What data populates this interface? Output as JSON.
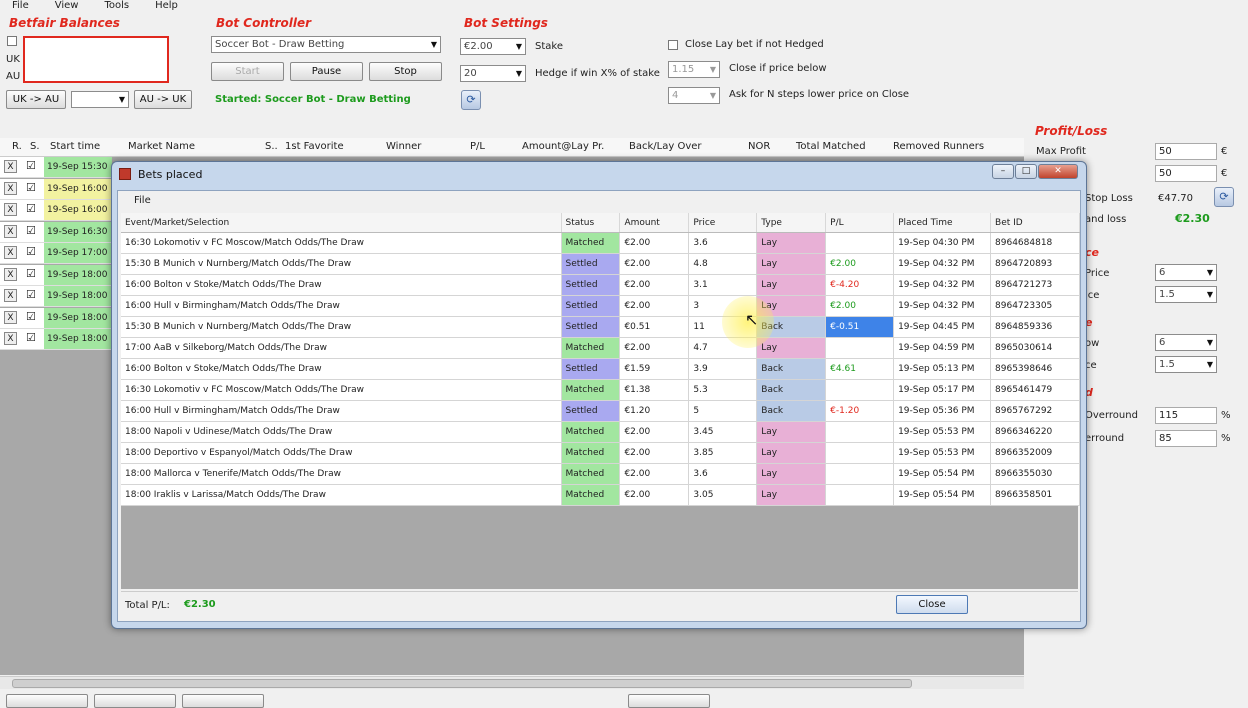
{
  "menu": [
    "File",
    "View",
    "Tools",
    "Help"
  ],
  "balances": {
    "title": "Betfair Balances",
    "uk_label": "UK",
    "au_label": "AU",
    "uk_to_au": "UK -> AU",
    "au_to_uk": "AU -> UK"
  },
  "bot_controller": {
    "title": "Bot Controller",
    "bot_select": "Soccer Bot - Draw Betting",
    "start": "Start",
    "pause": "Pause",
    "stop": "Stop",
    "status": "Started: Soccer Bot - Draw Betting"
  },
  "bot_settings": {
    "title": "Bot Settings",
    "stake_value": "€2.00",
    "stake_label": "Stake",
    "hedge_value": "20",
    "hedge_label": "Hedge if win X% of stake",
    "close_lay_label": "Close Lay bet if not Hedged",
    "close_price_value": "1.15",
    "close_price_label": "Close if price below",
    "ask_steps_value": "4",
    "ask_steps_label": "Ask for N steps lower price on Close"
  },
  "markets_grid": {
    "headers": [
      "R.",
      "S.",
      "Start time",
      "Market Name",
      "S..",
      "1st Favorite",
      "Winner",
      "P/L",
      "Amount@Lay Pr.",
      "Back/Lay Over",
      "NOR",
      "Total Matched",
      "Removed Runners"
    ],
    "rows": [
      {
        "x": "X",
        "chk": "☑",
        "time": "19-Sep 15:30",
        "color": "green"
      },
      {
        "x": "X",
        "chk": "☑",
        "time": "19-Sep 16:00",
        "color": "yellow"
      },
      {
        "x": "X",
        "chk": "☑",
        "time": "19-Sep 16:00",
        "color": "yellow"
      },
      {
        "x": "X",
        "chk": "☑",
        "time": "19-Sep 16:30",
        "color": "green"
      },
      {
        "x": "X",
        "chk": "☑",
        "time": "19-Sep 17:00",
        "color": "green"
      },
      {
        "x": "X",
        "chk": "☑",
        "time": "19-Sep 18:00",
        "color": "green"
      },
      {
        "x": "X",
        "chk": "☑",
        "time": "19-Sep 18:00",
        "color": "green"
      },
      {
        "x": "X",
        "chk": "☑",
        "time": "19-Sep 18:00",
        "color": "green"
      },
      {
        "x": "X",
        "chk": "☑",
        "time": "19-Sep 18:00",
        "color": "green"
      }
    ]
  },
  "profit_loss": {
    "title": "Profit/Loss",
    "max_profit_label": "Max Profit",
    "max_profit_value": "50",
    "max_profit_unit": "€",
    "row2_value": "50",
    "row2_unit": "€",
    "stop_loss_label": "Stop Loss",
    "stop_loss_value": "€47.70",
    "and_loss_label": "and loss",
    "and_loss_value": "€2.30",
    "section2_title": "ce",
    "price_label": "Price",
    "price_value": "6",
    "price2_label": "ice",
    "price2_value": "1.5",
    "section3_title": "e",
    "ow_label": "ow",
    "ow_value": "6",
    "ce_label": "ce",
    "ce_value": "1.5",
    "section4_title": "d",
    "overround_label": "Overround",
    "overround_value": "115",
    "overround_unit": "%",
    "erround_label": "erround",
    "erround_value": "85",
    "erround_unit": "%"
  },
  "dialog": {
    "title": "Bets placed",
    "menu_file": "File",
    "headers": [
      "Event/Market/Selection",
      "Status",
      "Amount",
      "Price",
      "Type",
      "P/L",
      "Placed Time",
      "Bet ID"
    ],
    "rows": [
      {
        "event": "16:30 Lokomotiv v FC Moscow/Match Odds/The Draw",
        "status": "Matched",
        "amount": "€2.00",
        "price": "3.6",
        "type": "Lay",
        "pl": "",
        "time": "19-Sep 04:30 PM",
        "id": "8964684818"
      },
      {
        "event": "15:30 B Munich v Nurnberg/Match Odds/The Draw",
        "status": "Settled",
        "amount": "€2.00",
        "price": "4.8",
        "type": "Lay",
        "pl": "€2.00",
        "time": "19-Sep 04:32 PM",
        "id": "8964720893"
      },
      {
        "event": "16:00 Bolton v Stoke/Match Odds/The Draw",
        "status": "Settled",
        "amount": "€2.00",
        "price": "3.1",
        "type": "Lay",
        "pl": "€-4.20",
        "time": "19-Sep 04:32 PM",
        "id": "8964721273"
      },
      {
        "event": "16:00 Hull v Birmingham/Match Odds/The Draw",
        "status": "Settled",
        "amount": "€2.00",
        "price": "3",
        "type": "Lay",
        "pl": "€2.00",
        "time": "19-Sep 04:32 PM",
        "id": "8964723305"
      },
      {
        "event": "15:30 B Munich v Nurnberg/Match Odds/The Draw",
        "status": "Settled",
        "amount": "€0.51",
        "price": "11",
        "type": "Back",
        "pl": "€-0.51",
        "time": "19-Sep 04:45 PM",
        "id": "8964859336"
      },
      {
        "event": "17:00 AaB v Silkeborg/Match Odds/The Draw",
        "status": "Matched",
        "amount": "€2.00",
        "price": "4.7",
        "type": "Lay",
        "pl": "",
        "time": "19-Sep 04:59 PM",
        "id": "8965030614"
      },
      {
        "event": "16:00 Bolton v Stoke/Match Odds/The Draw",
        "status": "Settled",
        "amount": "€1.59",
        "price": "3.9",
        "type": "Back",
        "pl": "€4.61",
        "time": "19-Sep 05:13 PM",
        "id": "8965398646"
      },
      {
        "event": "16:30 Lokomotiv v FC Moscow/Match Odds/The Draw",
        "status": "Matched",
        "amount": "€1.38",
        "price": "5.3",
        "type": "Back",
        "pl": "",
        "time": "19-Sep 05:17 PM",
        "id": "8965461479"
      },
      {
        "event": "16:00 Hull v Birmingham/Match Odds/The Draw",
        "status": "Settled",
        "amount": "€1.20",
        "price": "5",
        "type": "Back",
        "pl": "€-1.20",
        "time": "19-Sep 05:36 PM",
        "id": "8965767292"
      },
      {
        "event": "18:00 Napoli v Udinese/Match Odds/The Draw",
        "status": "Matched",
        "amount": "€2.00",
        "price": "3.45",
        "type": "Lay",
        "pl": "",
        "time": "19-Sep 05:53 PM",
        "id": "8966346220"
      },
      {
        "event": "18:00 Deportivo v Espanyol/Match Odds/The Draw",
        "status": "Matched",
        "amount": "€2.00",
        "price": "3.85",
        "type": "Lay",
        "pl": "",
        "time": "19-Sep 05:53 PM",
        "id": "8966352009"
      },
      {
        "event": "18:00 Mallorca v Tenerife/Match Odds/The Draw",
        "status": "Matched",
        "amount": "€2.00",
        "price": "3.6",
        "type": "Lay",
        "pl": "",
        "time": "19-Sep 05:54 PM",
        "id": "8966355030"
      },
      {
        "event": "18:00 Iraklis v Larissa/Match Odds/The Draw",
        "status": "Matched",
        "amount": "€2.00",
        "price": "3.05",
        "type": "Lay",
        "pl": "",
        "time": "19-Sep 05:54 PM",
        "id": "8966358501"
      }
    ],
    "total_label": "Total P/L:",
    "total_value": "€2.30",
    "close": "Close"
  },
  "colors": {
    "matched": "#a2e6a0",
    "settled": "#a9a9f0",
    "lay": "#e8b0d6",
    "back": "#b9cbe6",
    "accent_red": "#e0281e",
    "accent_green": "#1d9b1d"
  }
}
